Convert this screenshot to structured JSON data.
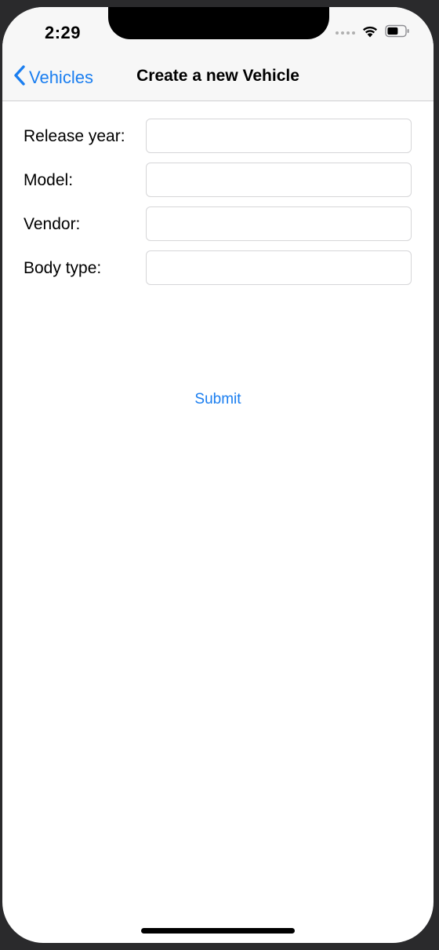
{
  "status_bar": {
    "time": "2:29"
  },
  "nav": {
    "back_label": "Vehicles",
    "title": "Create a new Vehicle"
  },
  "form": {
    "fields": [
      {
        "label": "Release year:",
        "value": "",
        "placeholder": ""
      },
      {
        "label": "Model:",
        "value": "",
        "placeholder": ""
      },
      {
        "label": "Vendor:",
        "value": "",
        "placeholder": ""
      },
      {
        "label": "Body type:",
        "value": "",
        "placeholder": ""
      }
    ],
    "submit_label": "Submit"
  },
  "colors": {
    "accent": "#1a7ef0",
    "nav_background": "#f7f7f7",
    "input_border": "#d6d6d8"
  },
  "icons": {
    "back": "chevron-left-icon",
    "signal": "cellular-signal-icon",
    "wifi": "wifi-icon",
    "battery": "battery-icon"
  }
}
